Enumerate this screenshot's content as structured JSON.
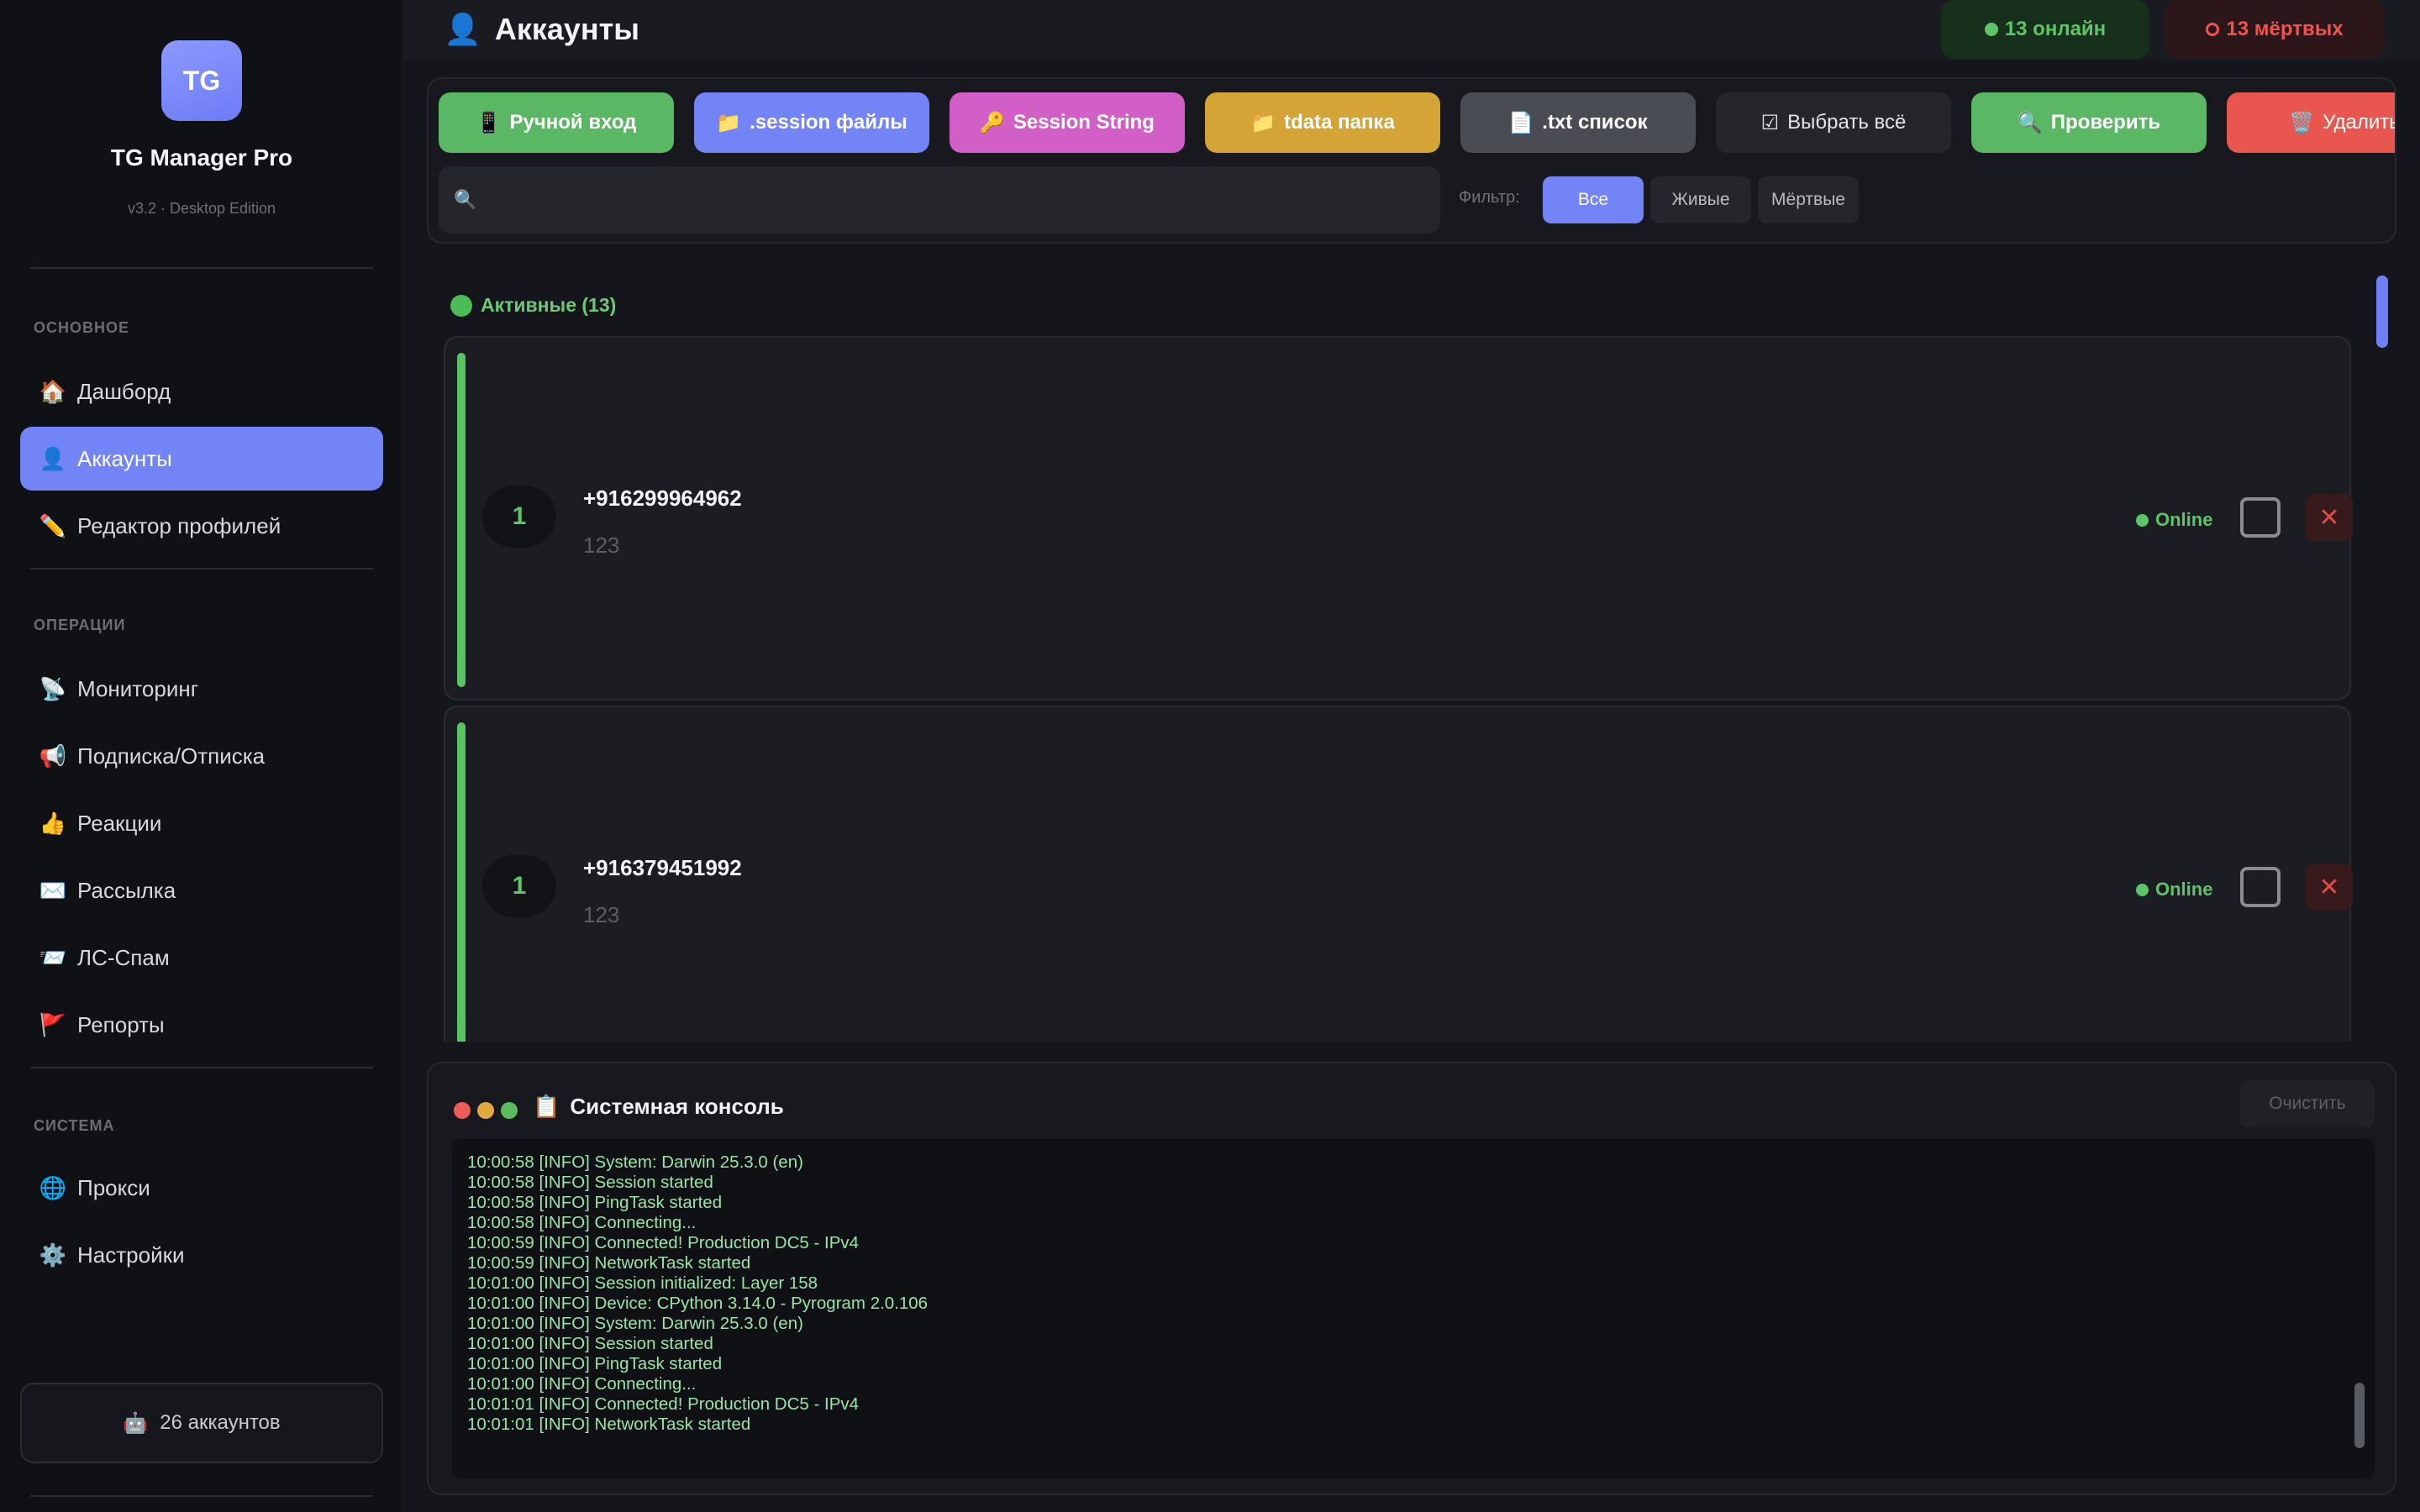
{
  "app": {
    "logo_text": "TG",
    "title": "TG Manager Pro",
    "version": "v3.2 · Desktop Edition"
  },
  "sidebar": {
    "sections": [
      {
        "label": "ОСНОВНОЕ"
      },
      {
        "label": "ОПЕРАЦИИ"
      },
      {
        "label": "СИСТЕМА"
      }
    ],
    "items": [
      {
        "label": "Дашборд",
        "icon": "🏠",
        "icon_name": "house-icon"
      },
      {
        "label": "Аккаунты",
        "icon": "👤",
        "icon_name": "user-icon",
        "active": true
      },
      {
        "label": "Редактор профилей",
        "icon": "✏️",
        "icon_name": "pencil-icon"
      },
      {
        "label": "Мониторинг",
        "icon": "📡",
        "icon_name": "satellite-icon"
      },
      {
        "label": "Подписка/Отписка",
        "icon": "📢",
        "icon_name": "megaphone-icon"
      },
      {
        "label": "Реакции",
        "icon": "👍",
        "icon_name": "thumbs-up-icon"
      },
      {
        "label": "Рассылка",
        "icon": "✉️",
        "icon_name": "envelope-icon"
      },
      {
        "label": "ЛС-Спам",
        "icon": "📨",
        "icon_name": "incoming-envelope-icon"
      },
      {
        "label": "Репорты",
        "icon": "🚩",
        "icon_name": "flag-icon"
      },
      {
        "label": "Прокси",
        "icon": "🌐",
        "icon_name": "globe-icon"
      },
      {
        "label": "Настройки",
        "icon": "⚙️",
        "icon_name": "gear-icon"
      }
    ],
    "footer": {
      "label": "26 аккаунтов",
      "icon": "🤖",
      "icon_name": "robot-icon"
    }
  },
  "header": {
    "title": "Аккаунты",
    "title_icon": "👤",
    "online_label": "13 онлайн",
    "dead_label": "13 мёртвых"
  },
  "toolbar": {
    "buttons": [
      {
        "label": "Ручной вход",
        "icon": "📱",
        "icon_name": "phone-icon",
        "color": "#5ab864"
      },
      {
        "label": ".session файлы",
        "icon": "📁",
        "icon_name": "folder-icon",
        "color": "#7384f7"
      },
      {
        "label": "Session String",
        "icon": "🔑",
        "icon_name": "key-icon",
        "color": "#d25fc7"
      },
      {
        "label": "tdata папка",
        "icon": "📁",
        "icon_name": "folder-icon",
        "color": "#d4a437"
      },
      {
        "label": ".txt список",
        "icon": "📄",
        "icon_name": "document-icon",
        "color": "#4a4c54"
      },
      {
        "label": "Выбрать всё",
        "icon": "☑",
        "icon_name": "checkbox-icon",
        "color": "#24262c"
      },
      {
        "label": "Проверить",
        "icon": "🔍",
        "icon_name": "magnifier-icon",
        "color": "#5ab864"
      },
      {
        "label": "Удалить",
        "icon": "🗑️",
        "icon_name": "trash-icon",
        "color": "#e8564f"
      }
    ],
    "search": {
      "value": "",
      "placeholder": "",
      "icon": "🔍"
    },
    "filter_label": "Фильтр:",
    "filters": [
      {
        "label": "Все",
        "active": true
      },
      {
        "label": "Живые",
        "active": false
      },
      {
        "label": "Мёртвые",
        "active": false
      }
    ]
  },
  "accounts": {
    "group_title": "Активные (13)",
    "items": [
      {
        "num": "1",
        "phone": "+916299964962",
        "sub": "123",
        "status": "Online"
      },
      {
        "num": "1",
        "phone": "+916379451992",
        "sub": "123",
        "status": "Online"
      }
    ]
  },
  "console": {
    "title": "Системная консоль",
    "title_icon": "📋",
    "clear_label": "Очистить",
    "lines": [
      "10:00:58 [INFO] System: Darwin 25.3.0 (en)",
      "10:00:58 [INFO] Session started",
      "10:00:58 [INFO] PingTask started",
      "10:00:58 [INFO] Connecting...",
      "10:00:59 [INFO] Connected! Production DC5 - IPv4",
      "10:00:59 [INFO] NetworkTask started",
      "10:01:00 [INFO] Session initialized: Layer 158",
      "10:01:00 [INFO] Device: CPython 3.14.0 - Pyrogram 2.0.106",
      "10:01:00 [INFO] System: Darwin 25.3.0 (en)",
      "10:01:00 [INFO] Session started",
      "10:01:00 [INFO] PingTask started",
      "10:01:00 [INFO] Connecting...",
      "10:01:01 [INFO] Connected! Production DC5 - IPv4",
      "10:01:01 [INFO] NetworkTask started"
    ]
  },
  "colors": {
    "accent": "#7384f7",
    "online": "#5ec46a",
    "dead": "#ef5350",
    "background": "#15161b"
  }
}
